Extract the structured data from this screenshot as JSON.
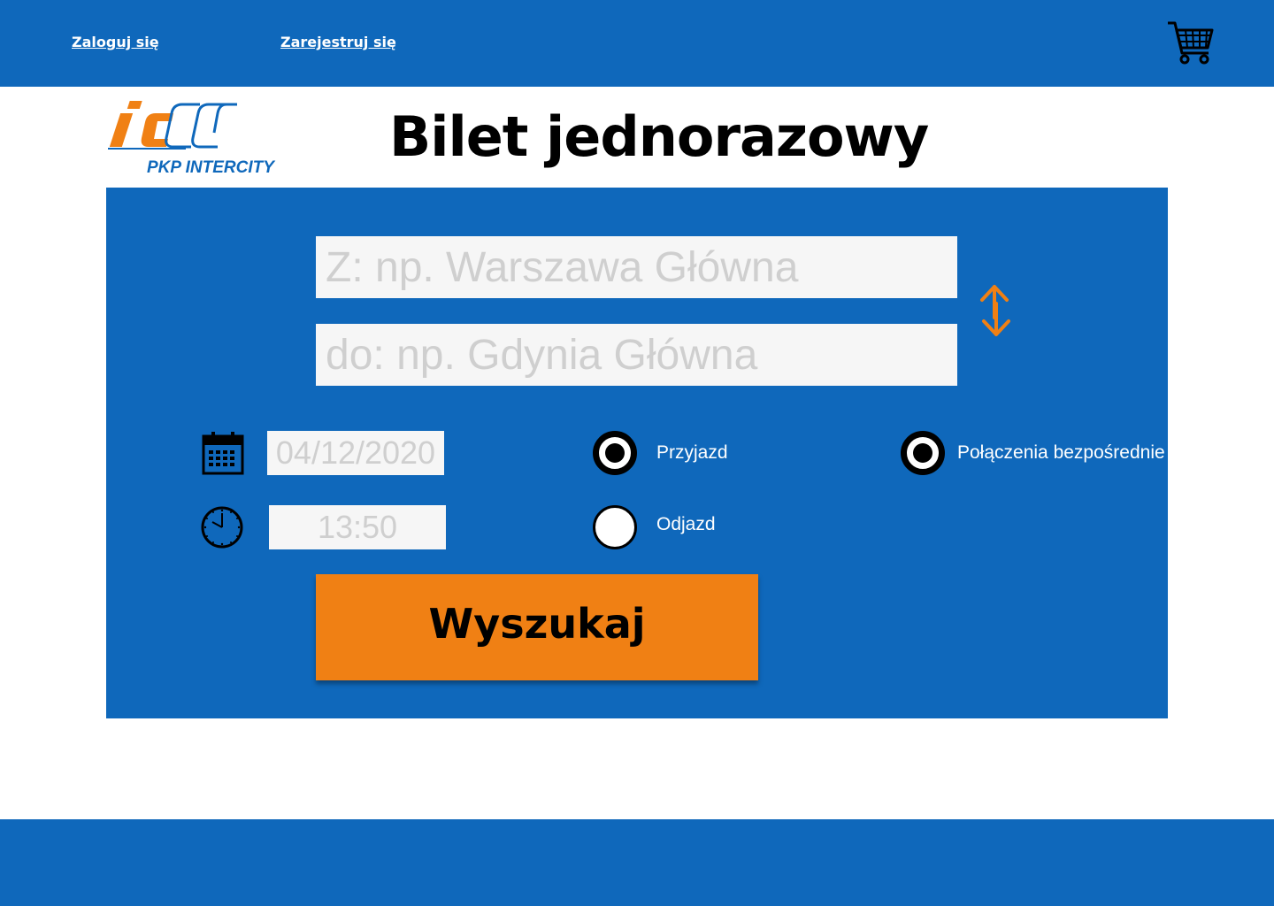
{
  "header": {
    "login_label": "Zaloguj się",
    "register_label": "Zarejestruj się",
    "cart_icon": "shopping-cart-icon"
  },
  "logo": {
    "mark": "iC",
    "text": "PKP INTERCITY"
  },
  "page": {
    "title": "Bilet jednorazowy"
  },
  "form": {
    "from_placeholder": "Z: np. Warszawa Główna",
    "to_placeholder": "do: np. Gdynia Główna",
    "swap_icon": "swap-arrows-icon",
    "date_icon": "calendar-icon",
    "date_value": "04/12/2020",
    "time_icon": "clock-icon",
    "time_value": "13:50",
    "arrival_label": "Przyjazd",
    "arrival_selected": true,
    "departure_label": "Odjazd",
    "departure_selected": false,
    "direct_label": "Połączenia bezpośrednie",
    "direct_selected": true,
    "search_label": "Wyszukaj"
  },
  "colors": {
    "brand_blue": "#0f68bb",
    "accent_orange": "#f08014",
    "input_bg": "#f6f6f6",
    "placeholder": "#cfcfcf"
  }
}
